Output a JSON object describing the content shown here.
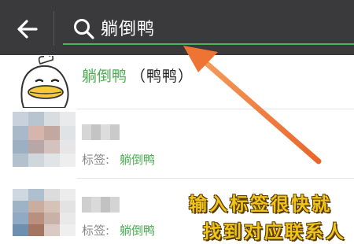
{
  "search": {
    "query": "躺倒鸭"
  },
  "contact": {
    "name_highlight": "躺倒鸭",
    "name_suffix": "（鸭鸭）"
  },
  "results": [
    {
      "tag_label": "标签:",
      "tag_value": "躺倒鸭"
    },
    {
      "tag_label": "标签:",
      "tag_value": "躺倒鸭"
    }
  ],
  "annotation": {
    "line1": "输入标签很快就",
    "line2": "找到对应联系人"
  },
  "colors": {
    "accent_green": "#4cae52",
    "topbar": "#3a3a3c",
    "arrow": "#f07a3a",
    "annotation": "#f1c41a"
  }
}
